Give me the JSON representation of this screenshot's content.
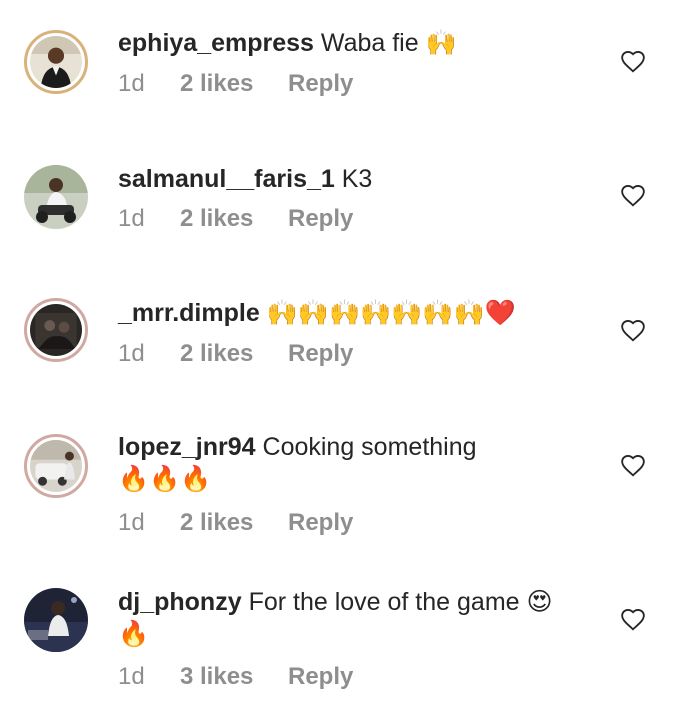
{
  "comments": [
    {
      "username": "ephiya_empress",
      "text": "Waba fie",
      "emoji_line1": "🙌",
      "emoji_line2": "",
      "time": "1d",
      "likes": "2 likes",
      "reply": "Reply"
    },
    {
      "username": "salmanul__faris_1",
      "text": "K3",
      "emoji_line1": "",
      "emoji_line2": "",
      "time": "1d",
      "likes": "2 likes",
      "reply": "Reply"
    },
    {
      "username": "_mrr.dimple",
      "text": "",
      "emoji_line1": "🙌🙌🙌🙌🙌🙌🙌❤️",
      "emoji_line2": "",
      "time": "1d",
      "likes": "2 likes",
      "reply": "Reply"
    },
    {
      "username": "lopez_jnr94",
      "text": "Cooking something",
      "emoji_line1": "",
      "emoji_line2": "🔥🔥🔥",
      "time": "1d",
      "likes": "2 likes",
      "reply": "Reply"
    },
    {
      "username": "dj_phonzy",
      "text": "For the love of the game",
      "emoji_line1": "😍",
      "emoji_line2": "🔥",
      "time": "1d",
      "likes": "3 likes",
      "reply": "Reply"
    }
  ],
  "icons": {
    "like": "heart-outline-icon",
    "avatar": "user-avatar"
  },
  "colors": {
    "text": "#262626",
    "muted": "#8e8e8e",
    "ring": "#d9b27a"
  }
}
